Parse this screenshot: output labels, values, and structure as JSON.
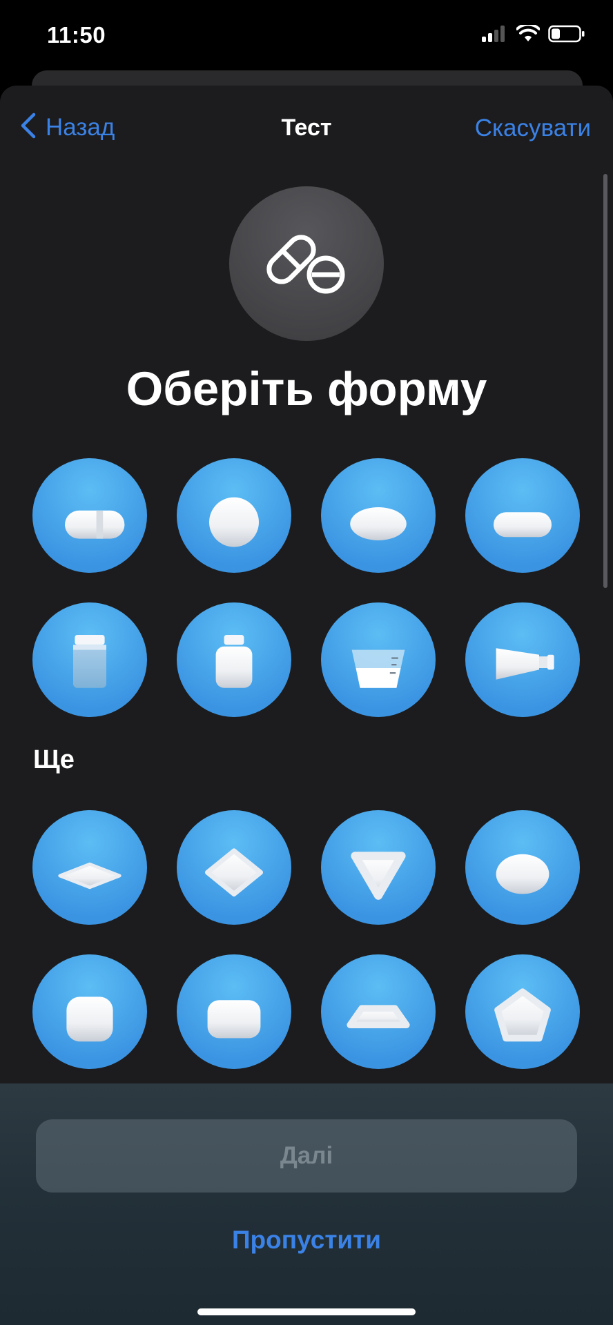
{
  "status": {
    "time": "11:50"
  },
  "nav": {
    "back_label": "Назад",
    "title": "Тест",
    "cancel_label": "Скасувати"
  },
  "heading": "Оберіть форму",
  "shapes": [
    {
      "name": "capsule"
    },
    {
      "name": "round-tablet"
    },
    {
      "name": "oval-tablet"
    },
    {
      "name": "oblong-tablet"
    },
    {
      "name": "pill-bottle"
    },
    {
      "name": "medicine-bottle"
    },
    {
      "name": "measuring-cup"
    },
    {
      "name": "tube"
    }
  ],
  "more_label": "Ще",
  "more_shapes": [
    {
      "name": "flat-diamond"
    },
    {
      "name": "diamond"
    },
    {
      "name": "triangle"
    },
    {
      "name": "egg"
    },
    {
      "name": "rounded-square"
    },
    {
      "name": "rectangle"
    },
    {
      "name": "trapezoid"
    },
    {
      "name": "pentagon"
    }
  ],
  "buttons": {
    "next": "Далі",
    "skip": "Пропустити"
  },
  "colors": {
    "accent": "#3b82e6",
    "shape_button": "#4aa8ec",
    "sheet": "#1c1c1e"
  }
}
